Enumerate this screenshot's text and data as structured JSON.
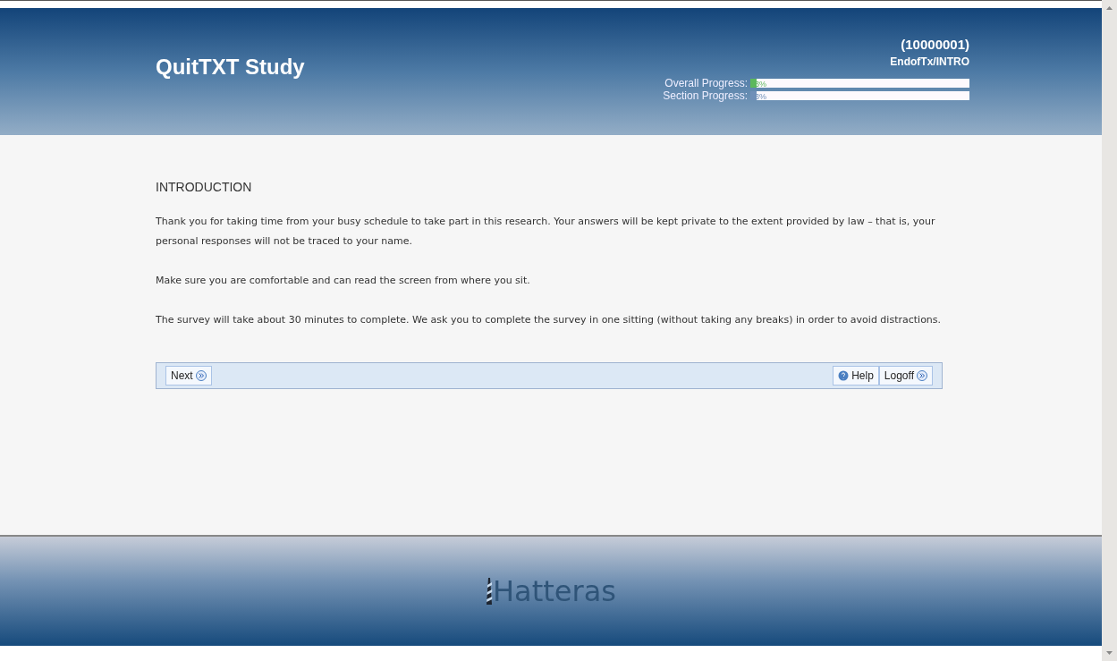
{
  "header": {
    "title": "QuitTXT Study",
    "participant_id": "(10000001)",
    "section_code": "EndofTx/INTRO",
    "progress": [
      {
        "label": "Overall Progress:",
        "level": 0.03,
        "reading": "3%",
        "color": "#5cb85c"
      },
      {
        "label": "Section Progress:",
        "level": 0.03,
        "reading": "3%",
        "color": "#6f8fb8"
      }
    ]
  },
  "content": {
    "heading": "INTRODUCTION",
    "paragraphs": [
      "Thank you for taking time from your busy schedule to take part in this research.  Your answers will be kept private to the extent provided by law – that is, your personal responses will not be traced to your name.",
      "Make sure you are comfortable and can read the screen from where you sit.",
      "The survey will take about 30 minutes to complete. We ask you to complete the survey in one sitting (without taking any breaks) in order to avoid distractions."
    ]
  },
  "toolbar": {
    "left": [
      {
        "label": "Next",
        "kind": "next"
      }
    ],
    "right": [
      {
        "label": "Help",
        "kind": "help"
      },
      {
        "label": "Logoff",
        "kind": "next"
      }
    ]
  },
  "footer": {
    "logo": "Hatteras"
  }
}
